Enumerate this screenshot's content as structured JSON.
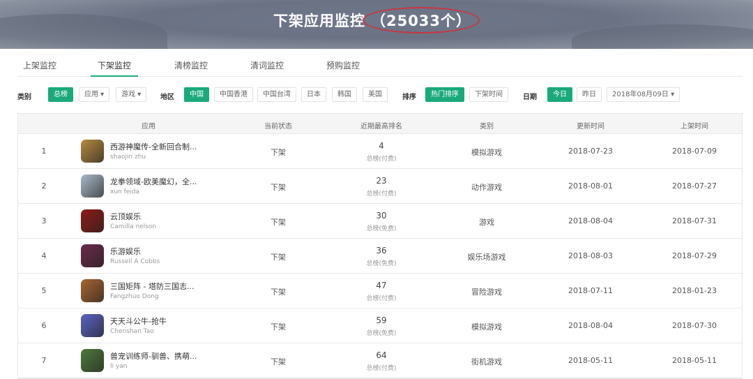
{
  "header": {
    "title": "下架应用监控",
    "count": "（25033个）"
  },
  "tabs": [
    "上架监控",
    "下架监控",
    "清榜监控",
    "清词监控",
    "预购监控"
  ],
  "filters": {
    "category_label": "类别",
    "category": [
      "总榜",
      "应用 ▾",
      "游戏 ▾"
    ],
    "region_label": "地区",
    "region": [
      "中国",
      "中国香港",
      "中国台湾",
      "日本",
      "韩国",
      "美国"
    ],
    "sort_label": "排序",
    "sort": [
      "热门排序",
      "下架时间"
    ],
    "date_label": "日期",
    "date": [
      "今日",
      "昨日"
    ],
    "date_select": "2018年08月09日 ▾"
  },
  "columns": [
    "应用",
    "当前状态",
    "近期最高排名",
    "类别",
    "更新时间",
    "上架时间"
  ],
  "rows": [
    {
      "no": "1",
      "name": "西游神魔传-全新回合制...",
      "dev": "shaojin zhu",
      "status": "下架",
      "rank": "4",
      "rank_type": "总榜(付费)",
      "category": "模拟游戏",
      "updated": "2018-07-23",
      "released": "2018-07-09",
      "color": "#b58a3e"
    },
    {
      "no": "2",
      "name": "龙拳领域-欧美魔幻，全...",
      "dev": "xun feida",
      "status": "下架",
      "rank": "23",
      "rank_type": "总榜(付费)",
      "category": "动作游戏",
      "updated": "2018-08-01",
      "released": "2018-07-27",
      "color": "#a9b9c8"
    },
    {
      "no": "3",
      "name": "云顶娱乐",
      "dev": "Camilla nelson",
      "status": "下架",
      "rank": "30",
      "rank_type": "总榜(免费)",
      "category": "游戏",
      "updated": "2018-08-04",
      "released": "2018-07-31",
      "color": "#8e1b16"
    },
    {
      "no": "4",
      "name": "乐游娱乐",
      "dev": "Russell A Cobbs",
      "status": "下架",
      "rank": "36",
      "rank_type": "总榜(免费)",
      "category": "娱乐场游戏",
      "updated": "2018-08-03",
      "released": "2018-07-29",
      "color": "#6a2a4a"
    },
    {
      "no": "5",
      "name": "三国矩阵 - 塔防三国志...",
      "dev": "Fangzhuo Dong",
      "status": "下架",
      "rank": "47",
      "rank_type": "总榜(付费)",
      "category": "冒险游戏",
      "updated": "2018-07-11",
      "released": "2018-01-23",
      "color": "#a8652f"
    },
    {
      "no": "6",
      "name": "天天斗公牛-抢牛",
      "dev": "Chenshan Tao",
      "status": "下架",
      "rank": "59",
      "rank_type": "总榜(免费)",
      "category": "模拟游戏",
      "updated": "2018-08-04",
      "released": "2018-07-30",
      "color": "#5a63c4"
    },
    {
      "no": "7",
      "name": "兽宠训练师-驯兽、携萌...",
      "dev": "li yan",
      "status": "下架",
      "rank": "64",
      "rank_type": "总榜(付费)",
      "category": "街机游戏",
      "updated": "2018-05-11",
      "released": "2018-05-11",
      "color": "#4f7a3a"
    }
  ]
}
